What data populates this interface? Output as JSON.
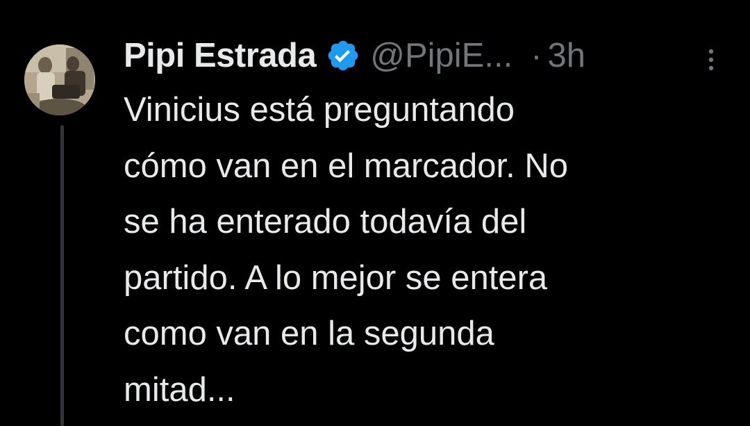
{
  "tweet": {
    "display_name": "Pipi Estrada",
    "handle": "@PipiE...",
    "separator": "·",
    "timestamp": "3h",
    "verified": true,
    "text_lines": [
      "Vinicius está preguntando",
      "cómo van en el marcador. No",
      "se ha enterado todavía del",
      "partido. A lo mejor se entera",
      "como van en la segunda",
      "mitad..."
    ]
  },
  "icons": {
    "verified": "verified-badge-icon",
    "more": "more-options-icon"
  },
  "colors": {
    "background": "#000000",
    "primary_text": "#e7e9ea",
    "secondary_text": "#71767b",
    "verified_blue": "#1d9bf0",
    "thread_line": "#333639"
  }
}
